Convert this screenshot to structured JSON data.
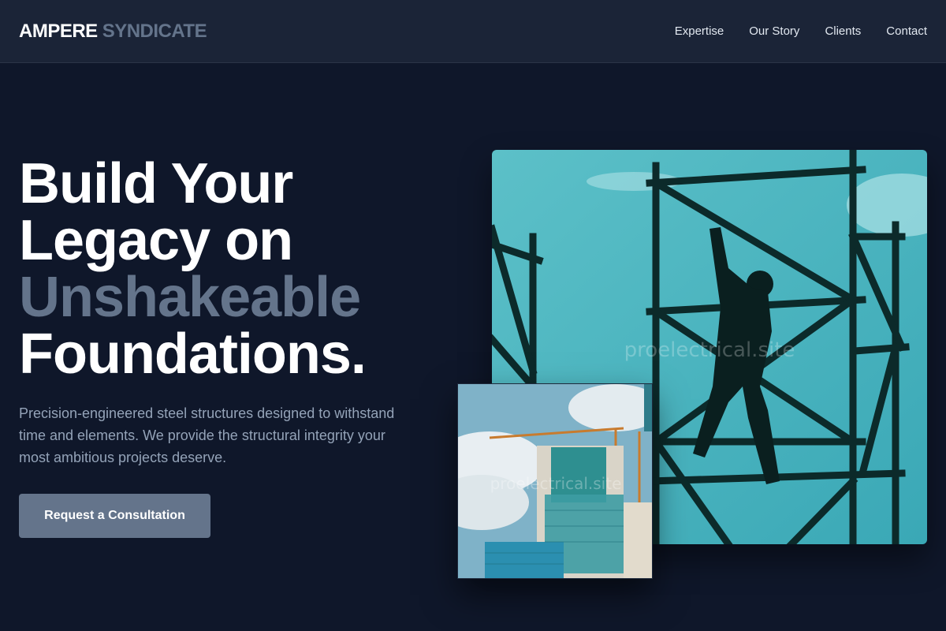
{
  "header": {
    "brand_primary": "AMPERE",
    "brand_secondary": "SYNDICATE",
    "nav": [
      "Expertise",
      "Our Story",
      "Clients",
      "Contact"
    ]
  },
  "hero": {
    "title_lines": [
      "Build Your",
      "Legacy on",
      "Unshakeable",
      "Foundations."
    ],
    "description": "Precision-engineered steel structures designed to withstand time and elements. We provide the structural integrity your most ambitious projects deserve.",
    "cta_label": "Request a Consultation"
  },
  "images": {
    "main_watermark": "proelectrical.site",
    "small_watermark": "proelectrical.site"
  },
  "colors": {
    "background": "#0f172a",
    "header": "#1b2437",
    "accent": "#64748b",
    "sky": "#4fb3bf"
  }
}
